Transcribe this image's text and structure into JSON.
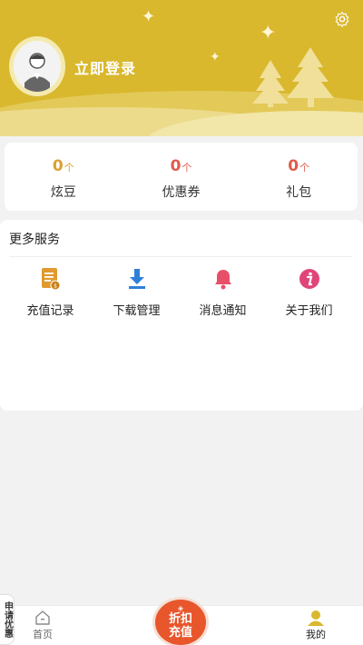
{
  "header": {
    "login_text": "立即登录",
    "bg_color": "#d9b82e"
  },
  "stats": [
    {
      "value": "0",
      "unit": "个",
      "label": "炫豆",
      "color": "#d9a032"
    },
    {
      "value": "0",
      "unit": "个",
      "label": "优惠券",
      "color": "#e05a4a"
    },
    {
      "value": "0",
      "unit": "个",
      "label": "礼包",
      "color": "#e05a4a"
    }
  ],
  "services": {
    "title": "更多服务",
    "items": [
      {
        "label": "充值记录",
        "icon": "recharge-record-icon",
        "color": "#e09a2e"
      },
      {
        "label": "下载管理",
        "icon": "download-icon",
        "color": "#2f7fd8"
      },
      {
        "label": "消息通知",
        "icon": "bell-icon",
        "color": "#e8506a"
      },
      {
        "label": "关于我们",
        "icon": "info-icon",
        "color": "#e0457a"
      }
    ]
  },
  "tabbar": {
    "home": "首页",
    "discount": "折扣\n充值",
    "mine": "我的",
    "side_tab": "申请优惠",
    "active_color": "#d9b82e",
    "fab_color": "#e8562c"
  }
}
